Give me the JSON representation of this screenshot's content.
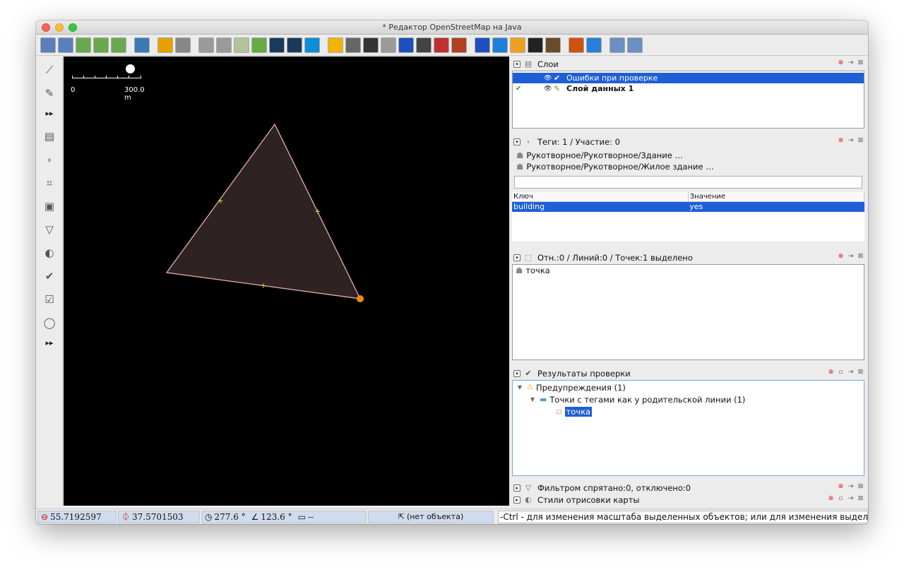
{
  "window": {
    "title": "* Редактор OpenStreetMap на Java"
  },
  "toolbar": {
    "buttons": [
      {
        "icon": "open-icon",
        "color": "#5a7fbf"
      },
      {
        "icon": "open-location-icon",
        "color": "#5a7fbf"
      },
      {
        "icon": "download-icon",
        "color": "#6aa84f"
      },
      {
        "icon": "download-along-icon",
        "color": "#6aa84f"
      },
      {
        "icon": "upload-icon",
        "color": "#6aa84f"
      },
      {
        "icon": "update-icon",
        "color": "#3c78b5"
      },
      {
        "icon": "undo-icon",
        "color": "#e6a100"
      },
      {
        "icon": "redo-icon",
        "color": "#888888"
      },
      {
        "icon": "preset-gray-1-icon",
        "color": "#9a9a9a"
      },
      {
        "icon": "preset-gray-2-icon",
        "color": "#9a9a9a"
      },
      {
        "icon": "wms-icon",
        "color": "#b0c49a"
      },
      {
        "icon": "search-icon",
        "color": "#66aa44"
      },
      {
        "icon": "road-1-icon",
        "color": "#1a3a5c"
      },
      {
        "icon": "road-2-icon",
        "color": "#1a3a5c"
      },
      {
        "icon": "bing-icon",
        "color": "#0a8fd8"
      },
      {
        "icon": "lane-yellow-icon",
        "color": "#f2b300"
      },
      {
        "icon": "lane-gray-icon",
        "color": "#666666"
      },
      {
        "icon": "lane-dark-icon",
        "color": "#333333"
      },
      {
        "icon": "lane-light-icon",
        "color": "#9a9a9a"
      },
      {
        "icon": "parking-icon",
        "color": "#1e4fbf"
      },
      {
        "icon": "traffic-light-icon",
        "color": "#444444"
      },
      {
        "icon": "brick-wall-icon",
        "color": "#c03030"
      },
      {
        "icon": "railway-icon",
        "color": "#b04020"
      },
      {
        "icon": "info-icon",
        "color": "#1e4fbf"
      },
      {
        "icon": "bed-icon",
        "color": "#1e7fd8"
      },
      {
        "icon": "shop-bag-icon",
        "color": "#f0a020"
      },
      {
        "icon": "football-icon",
        "color": "#222222"
      },
      {
        "icon": "factory-icon",
        "color": "#6a4a2a"
      },
      {
        "icon": "mountain-icon",
        "color": "#d05010"
      },
      {
        "icon": "river-icon",
        "color": "#2a7fd8"
      },
      {
        "icon": "zoom-1-icon",
        "color": "#6a8fc0"
      },
      {
        "icon": "zoom-2-icon",
        "color": "#6a8fc0"
      }
    ]
  },
  "leftbar": {
    "tools": [
      {
        "icon": "select-tool-icon",
        "glyph": "⟋"
      },
      {
        "icon": "draw-pencil-icon",
        "glyph": "✎"
      },
      {
        "icon": "more-arrow-icon",
        "glyph": "▸▸"
      },
      {
        "icon": "layers-panel-icon",
        "glyph": "▤"
      },
      {
        "icon": "tags-panel-icon",
        "glyph": "⬫"
      },
      {
        "icon": "relations-panel-icon",
        "glyph": "⌗"
      },
      {
        "icon": "imagery-panel-icon",
        "glyph": "▣"
      },
      {
        "icon": "filter-panel-icon",
        "glyph": "▽"
      },
      {
        "icon": "palette-panel-icon",
        "glyph": "◐"
      },
      {
        "icon": "validator-panel-icon",
        "glyph": "✔"
      },
      {
        "icon": "changeset-panel-icon",
        "glyph": "☑"
      },
      {
        "icon": "globe-panel-icon",
        "glyph": "◯"
      },
      {
        "icon": "more-arrow-2-icon",
        "glyph": "▸▸"
      }
    ]
  },
  "map": {
    "scale_zero": "0",
    "scale_label": "300.0 m",
    "polygon_fill": "#2e2222",
    "polygon_stroke": "#d9a5a5",
    "midpoint_color": "#e6e600",
    "selected_node_color": "#f08a12"
  },
  "layers": {
    "title": "Слои",
    "items": [
      {
        "name": "Ошибки при проверке",
        "selected": true,
        "active": false
      },
      {
        "name": "Слой данных 1",
        "selected": false,
        "active": true
      }
    ]
  },
  "tags": {
    "title": "Теги: 1 / Участие: 0",
    "presets": [
      "Рукотворное/Рукотворное/Здание …",
      "Рукотворное/Рукотворное/Жилое здание …"
    ],
    "col_key": "Ключ",
    "col_value": "Значение",
    "rows": [
      {
        "key": "building",
        "value": "yes"
      }
    ]
  },
  "selection": {
    "title": "Отн.:0 / Линий:0 / Точек:1 выделено",
    "items": [
      "точка"
    ]
  },
  "validation": {
    "title": "Результаты проверки",
    "warnings": "Предупреждения (1)",
    "group": "Точки с тегами как у родительской линии (1)",
    "item": "точка"
  },
  "filter": {
    "title": "Фильтром спрятано:0, отключено:0"
  },
  "styles": {
    "title": "Стили отрисовки карты"
  },
  "status": {
    "lat": "55.7192597",
    "lon": "37.5701503",
    "heading": "277.6 °",
    "angle": "123.6 °",
    "distance": "--",
    "object": "(нет объекта)",
    "help": "-Ctrl - для изменения масштаба выделенных объектов; или для изменения выделения"
  }
}
